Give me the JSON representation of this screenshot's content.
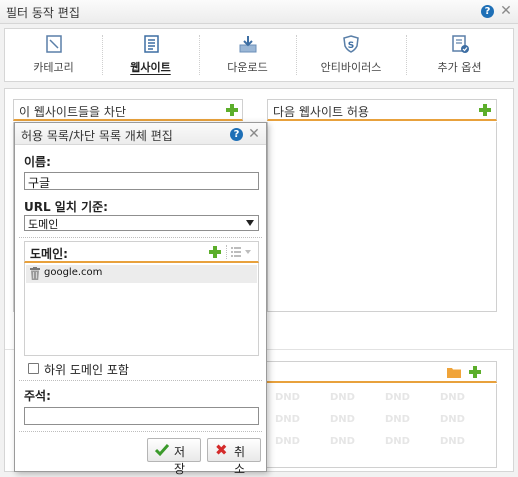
{
  "window": {
    "title": "필터 동작 편집",
    "help": "?",
    "close": "✕"
  },
  "tabs": [
    {
      "label": "카테고리",
      "icon": "category-icon"
    },
    {
      "label": "웹사이트",
      "icon": "website-list-icon",
      "active": true
    },
    {
      "label": "다운로드",
      "icon": "download-icon"
    },
    {
      "label": "안티바이러스",
      "icon": "antivirus-shield-icon"
    },
    {
      "label": "추가 옵션",
      "icon": "extra-options-icon"
    }
  ],
  "panes": {
    "block": {
      "title": "이 웹사이트들을 차단"
    },
    "allow": {
      "title": "다음 웹사이트 허용"
    },
    "dnd_label": "DND"
  },
  "dialog": {
    "title": "허용 목록/차단 목록 개체 편집",
    "name_label": "이름:",
    "name_value": "구글",
    "url_match_label": "URL 일치 기준:",
    "url_match_value": "도메인",
    "domain_label": "도메인:",
    "domains": [
      "google.com"
    ],
    "include_subdomains_label": "하위 도메인 포함",
    "include_subdomains_checked": false,
    "comment_label": "주석:",
    "comment_value": "",
    "save_label": "저장",
    "cancel_label": "취소"
  },
  "colors": {
    "accent_orange": "#e8a13c",
    "add_green": "#5cae2b",
    "help_blue": "#1e6fb6",
    "cancel_red": "#d42a2a"
  }
}
